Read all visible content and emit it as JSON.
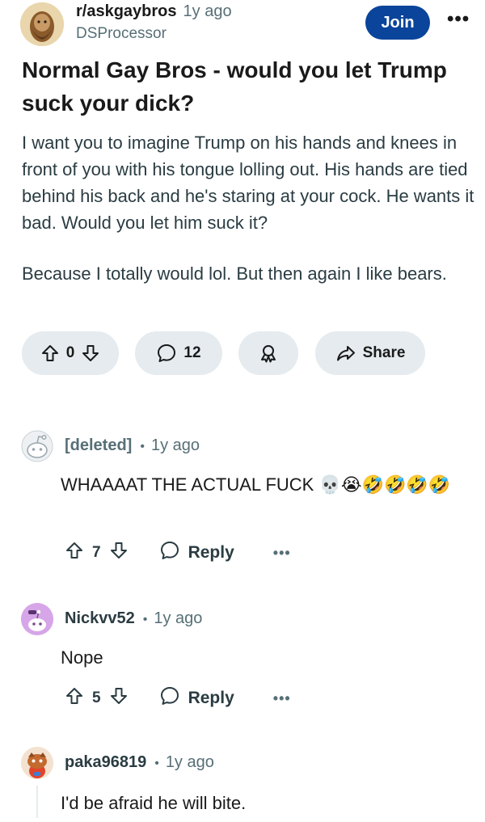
{
  "post": {
    "subreddit": "r/askgaybros",
    "time": "1y ago",
    "author": "DSProcessor",
    "join_label": "Join",
    "more_label": "•••",
    "title": "Normal Gay Bros - would you let Trump suck your dick?",
    "body": [
      "I want you to imagine Trump on his hands and knees in front of you with his tongue lolling out. His hands are tied behind his back and he's staring at your cock. He wants it bad. Would you let him suck it?",
      "Because I totally would lol. But then again I like bears."
    ],
    "votes": "0",
    "comments": "12",
    "share_label": "Share"
  },
  "comments": [
    {
      "author": "[deleted]",
      "time": "1y ago",
      "text": "WHAAAAT THE ACTUAL FUCK 💀😭🤣🤣🤣🤣",
      "votes": "7",
      "reply_label": "Reply",
      "more_label": "•••"
    },
    {
      "author": "Nickvv52",
      "time": "1y ago",
      "text": "Nope",
      "votes": "5",
      "reply_label": "Reply",
      "more_label": "•••"
    },
    {
      "author": "paka96819",
      "time": "1y ago",
      "text": "I'd be afraid he will bite."
    }
  ],
  "colors": {
    "join": "#0a449b",
    "pill": "#e5ebee",
    "meta": "#576f76"
  }
}
